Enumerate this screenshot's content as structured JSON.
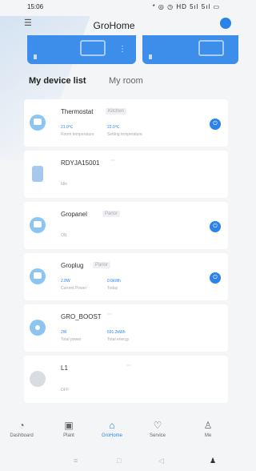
{
  "status_bar": {
    "time": "15:06",
    "right": "* ◎ ◷ HD 5ıl 5ıl ▭"
  },
  "header": {
    "menu_icon": "menu-icon",
    "title": "GroHome"
  },
  "tabs": {
    "device_list": "My device list",
    "room": "My room"
  },
  "devices": [
    {
      "name": "Thermostat",
      "tag": "Kitchen",
      "v1": "21.0℃",
      "l1": "Room temperature",
      "v2": "22.0℃",
      "l2": "Setting temperature",
      "has_power": true
    },
    {
      "name": "RDYJA15001",
      "tag": "",
      "sub": "Idle",
      "has_power": false
    },
    {
      "name": "Gropanel",
      "tag": "Parlor",
      "sub": "ON",
      "has_power": true
    },
    {
      "name": "Groplug",
      "tag": "Parlor",
      "v1": "2.8W",
      "l1": "Current Power",
      "v2": "0.0kWh",
      "l2": "Today",
      "has_power": true
    },
    {
      "name": "GRO_BOOST",
      "tag": "",
      "v1": "2W",
      "l1": "Total power",
      "v2": "591.2kWh",
      "l2": "Total energy",
      "has_power": false
    },
    {
      "name": "L1",
      "tag": "",
      "sub": "OFF",
      "has_power": false
    }
  ],
  "nav": [
    {
      "label": "Dashboard",
      "icon": "dashboard-icon"
    },
    {
      "label": "Plant",
      "icon": "plant-icon"
    },
    {
      "label": "GroHome",
      "icon": "home-icon",
      "active": true
    },
    {
      "label": "Service",
      "icon": "service-icon"
    },
    {
      "label": "Me",
      "icon": "me-icon"
    }
  ],
  "colors": {
    "accent": "#2a84e8",
    "background": "#f4f5f7"
  }
}
